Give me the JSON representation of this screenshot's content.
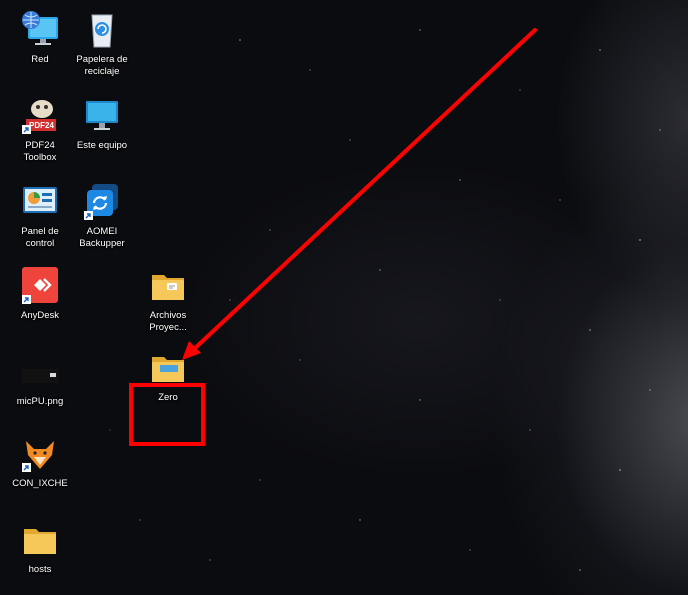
{
  "desktop": {
    "icons": [
      {
        "label": "Red",
        "icon": "network-icon"
      },
      {
        "label": "Papelera de\nreciclaje",
        "icon": "recycle-bin-icon"
      },
      {
        "label": "PDF24\nToolbox",
        "icon": "pdf24-icon"
      },
      {
        "label": "Este equipo",
        "icon": "this-pc-icon"
      },
      {
        "label": "Panel de\ncontrol",
        "icon": "control-panel-icon"
      },
      {
        "label": "AOMEI\nBackupper",
        "icon": "aomei-backupper-icon"
      },
      {
        "label": "AnyDesk",
        "icon": "anydesk-icon"
      },
      {
        "label": "Archivos\nProyec...",
        "icon": "folder-icon"
      },
      {
        "label": "micPU.png",
        "icon": "image-file-icon"
      },
      {
        "label": "Zero",
        "icon": "folder-icon"
      },
      {
        "label": "CON_IXCHE",
        "icon": "fox-app-icon"
      },
      {
        "label": "hosts",
        "icon": "folder-icon"
      }
    ]
  },
  "annotation": {
    "color": "#ff0000"
  },
  "colors": {
    "folder": "#f2c14e",
    "accent": "#ff0000"
  }
}
